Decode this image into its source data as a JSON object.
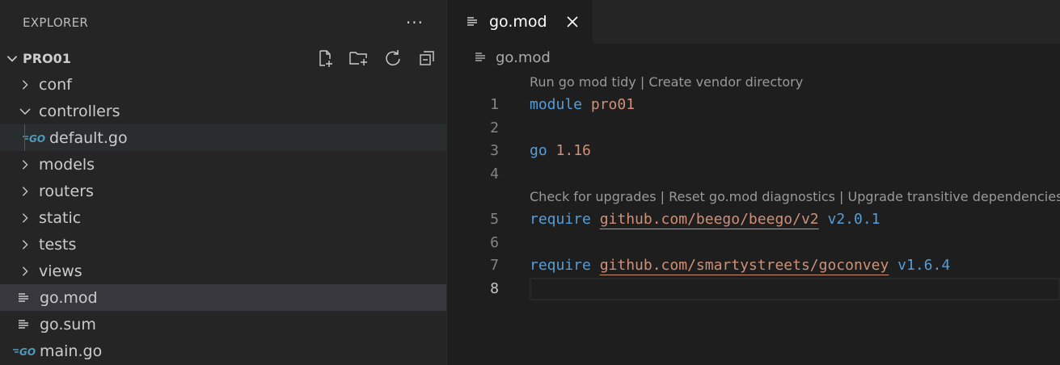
{
  "explorer": {
    "title": "EXPLORER",
    "more_label": "···",
    "project": "PRO01",
    "tree": [
      {
        "label": "conf",
        "kind": "folder",
        "state": "collapsed"
      },
      {
        "label": "controllers",
        "kind": "folder",
        "state": "expanded"
      },
      {
        "label": "default.go",
        "kind": "go-file",
        "state": "hover"
      },
      {
        "label": "models",
        "kind": "folder",
        "state": "collapsed"
      },
      {
        "label": "routers",
        "kind": "folder",
        "state": "collapsed"
      },
      {
        "label": "static",
        "kind": "folder",
        "state": "collapsed"
      },
      {
        "label": "tests",
        "kind": "folder",
        "state": "collapsed"
      },
      {
        "label": "views",
        "kind": "folder",
        "state": "collapsed"
      },
      {
        "label": "go.mod",
        "kind": "file",
        "state": "selected"
      },
      {
        "label": "go.sum",
        "kind": "file",
        "state": "normal"
      },
      {
        "label": "main.go",
        "kind": "go-file",
        "state": "normal"
      }
    ],
    "go_badge": "GO"
  },
  "editor": {
    "tab": {
      "label": "go.mod"
    },
    "breadcrumb": "go.mod",
    "codelens_top": {
      "a": "Run go mod tidy",
      "sep": " | ",
      "b": "Create vendor directory"
    },
    "codelens_mid": {
      "a": "Check for upgrades",
      "b": "Reset go.mod diagnostics",
      "c": "Upgrade transitive dependencies",
      "sep": " | ",
      "tail": " |"
    },
    "lines": {
      "l1": {
        "num": "1",
        "kw": "module",
        "val": "pro01"
      },
      "l2": {
        "num": "2"
      },
      "l3": {
        "num": "3",
        "kw": "go",
        "val": "1.16"
      },
      "l4": {
        "num": "4"
      },
      "l5": {
        "num": "5",
        "kw": "require",
        "mod": "github.com/beego/beego/v2",
        "ver": "v2.0.1"
      },
      "l6": {
        "num": "6"
      },
      "l7": {
        "num": "7",
        "kw": "require",
        "mod": "github.com/smartystreets/goconvey",
        "ver": "v1.6.4"
      },
      "l8": {
        "num": "8"
      }
    }
  },
  "colors": {
    "sidebar_bg": "#252526",
    "editor_bg": "#1e1e1e",
    "keyword": "#569cd6",
    "string": "#ce9178",
    "go_badge": "#519aba"
  }
}
